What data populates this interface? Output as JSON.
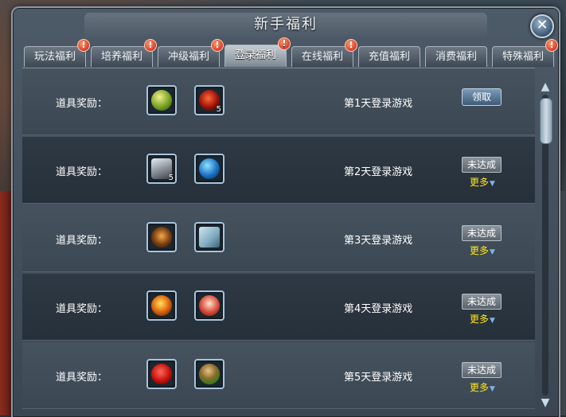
{
  "title": "新手福利",
  "close_label": "✕",
  "tabs": [
    {
      "label": "玩法福利",
      "alert": true
    },
    {
      "label": "培养福利",
      "alert": true
    },
    {
      "label": "冲级福利",
      "alert": true
    },
    {
      "label": "登录福利",
      "alert": true,
      "active": true
    },
    {
      "label": "在线福利",
      "alert": true
    },
    {
      "label": "充值福利",
      "alert": false
    },
    {
      "label": "消费福利",
      "alert": false
    },
    {
      "label": "特殊福利",
      "alert": true
    }
  ],
  "alert_mark": "!",
  "rows": [
    {
      "label": "道具奖励：",
      "day": "第1天登录游戏",
      "action": "领取",
      "more": "",
      "items": [
        {
          "icon": "green-gold-crest-icon",
          "count": ""
        },
        {
          "icon": "red-gourd-icon",
          "count": "5"
        }
      ]
    },
    {
      "label": "道具奖励：",
      "day": "第2天登录游戏",
      "action": "未达成",
      "more": "更多",
      "items": [
        {
          "icon": "silver-hat-icon",
          "count": "5"
        },
        {
          "icon": "blue-orb-icon",
          "count": ""
        }
      ]
    },
    {
      "label": "道具奖励：",
      "day": "第3天登录游戏",
      "action": "未达成",
      "more": "更多",
      "items": [
        {
          "icon": "bronze-bear-icon",
          "count": ""
        },
        {
          "icon": "scroll-icon",
          "count": ""
        }
      ]
    },
    {
      "label": "道具奖励：",
      "day": "第4天登录游戏",
      "action": "未达成",
      "more": "更多",
      "items": [
        {
          "icon": "fire-orb-icon",
          "count": ""
        },
        {
          "icon": "doll-icon",
          "count": ""
        }
      ]
    },
    {
      "label": "道具奖励：",
      "day": "第5天登录游戏",
      "action": "未达成",
      "more": "更多",
      "items": [
        {
          "icon": "red-orb-icon",
          "count": ""
        },
        {
          "icon": "green-bowl-icon",
          "count": ""
        }
      ]
    }
  ],
  "colors": {
    "more": "#ffe61a",
    "alert": "#c0161a"
  }
}
